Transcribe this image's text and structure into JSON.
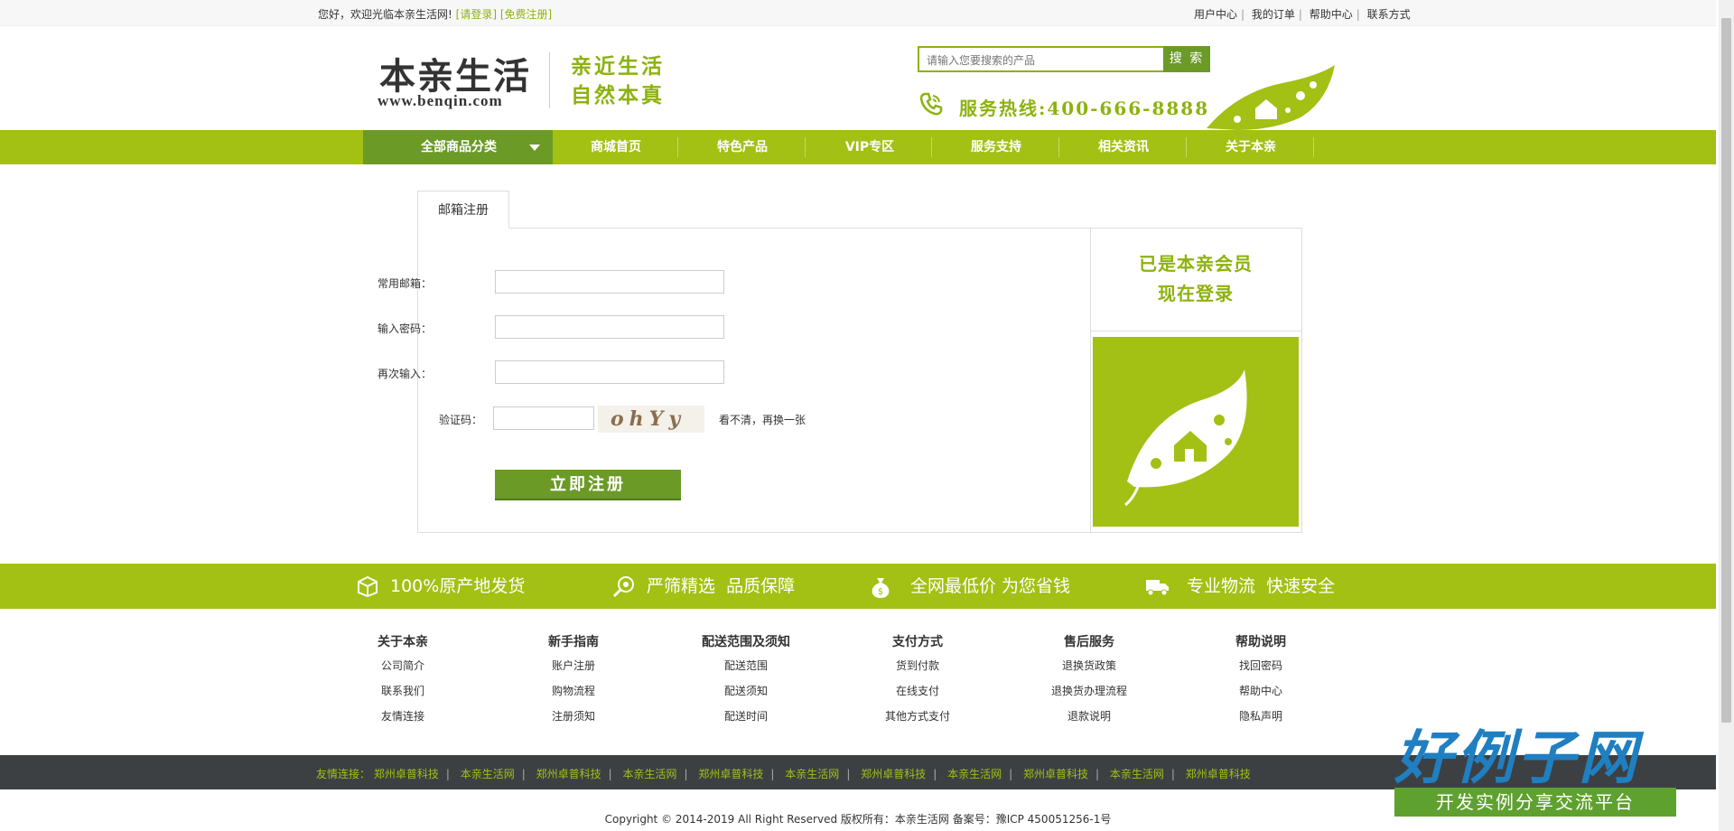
{
  "topbar": {
    "welcome": "您好，欢迎光临本亲生活网!",
    "login": "[请登录]",
    "register": "[免费注册]",
    "links": [
      "用户中心",
      "我的订单",
      "帮助中心",
      "联系方式"
    ]
  },
  "header": {
    "logo_cn": "本亲生活",
    "logo_url": "www.benqin.com",
    "slogan_line1": "亲近生活",
    "slogan_line2": "自然本真",
    "search_placeholder": "请输入您要搜索的产品",
    "search_button": "搜 索",
    "hotline": "服务热线:400-666-8888"
  },
  "nav": {
    "all_categories": "全部商品分类",
    "items": [
      "商城首页",
      "特色产品",
      "VIP专区",
      "服务支持",
      "相关资讯",
      "关于本亲"
    ]
  },
  "register": {
    "tab": "邮箱注册",
    "email_label": "常用邮箱：",
    "password_label": "输入密码：",
    "confirm_label": "再次输入：",
    "captcha_label": "验证码：",
    "captcha_text": "ohYy",
    "refresh_text": "看不清，再换一张",
    "submit": "立即注册",
    "side_line1": "已是本亲会员",
    "side_line2": "现在登录"
  },
  "features": [
    "100%原产地发货",
    "严筛精选  品质保障",
    "全网最低价 为您省钱",
    "专业物流  快速安全"
  ],
  "footer_columns": [
    {
      "title": "关于本亲",
      "links": [
        "公司简介",
        "联系我们",
        "友情连接"
      ]
    },
    {
      "title": "新手指南",
      "links": [
        "账户注册",
        "购物流程",
        "注册须知"
      ]
    },
    {
      "title": "配送范围及须知",
      "links": [
        "配送范围",
        "配送须知",
        "配送时间"
      ]
    },
    {
      "title": "支付方式",
      "links": [
        "货到付款",
        "在线支付",
        "其他方式支付"
      ]
    },
    {
      "title": "售后服务",
      "links": [
        "退换货政策",
        "退换货办理流程",
        "退款说明"
      ]
    },
    {
      "title": "帮助说明",
      "links": [
        "找回密码",
        "帮助中心",
        "隐私声明"
      ]
    }
  ],
  "friend_links": {
    "label": "友情连接：",
    "items": [
      "郑州卓普科技",
      "本亲生活网",
      "郑州卓普科技",
      "本亲生活网",
      "郑州卓普科技",
      "本亲生活网",
      "郑州卓普科技",
      "本亲生活网",
      "郑州卓普科技",
      "本亲生活网",
      "郑州卓普科技"
    ]
  },
  "copyright": "Copyright © 2014-2019 All Right Reserved 版权所有：本亲生活网 备案号：豫ICP 450051256-1号",
  "badge": {
    "title": "好例子网",
    "subtitle": "开发实例分享交流平台"
  },
  "colors": {
    "green": "#a3c014",
    "dark_green": "#6b9a27",
    "text_green": "#8db20e",
    "footer_dark": "#3d4043"
  }
}
